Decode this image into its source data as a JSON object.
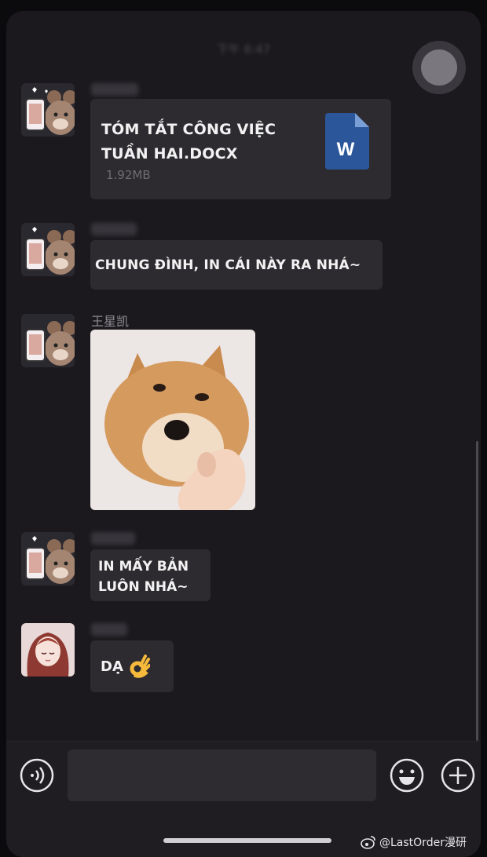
{
  "status": {
    "time_text": "下午 6:47"
  },
  "messages": [
    {
      "type": "file",
      "sender_name": "",
      "file_name": "TÓM TẮT CÔNG VIỆC TUẦN HAI.DOCX",
      "file_size": "1.92MB",
      "file_icon": "word-doc-icon"
    },
    {
      "type": "text",
      "sender_name": "",
      "text": "CHUNG ĐÌNH, IN CÁI NÀY RA NHÁ~"
    },
    {
      "type": "image",
      "sender_name": "王星凯",
      "image": "shiba-dog-pointing-photo"
    },
    {
      "type": "text",
      "sender_name": "",
      "text": "IN MẤY BẢN LUÔN NHÁ~"
    },
    {
      "type": "text",
      "sender_name": "",
      "text": "DẠ"
    }
  ],
  "input": {
    "placeholder": "",
    "value": ""
  },
  "icons": {
    "voice": "voice-icon",
    "emoji": "emoji-icon",
    "add": "add-icon",
    "ok_hand": "ok-hand-emoji"
  },
  "watermark": {
    "text": "@LastOrder漫研"
  },
  "colors": {
    "background": "#1b191e",
    "bubble": "#2d2b30",
    "word_blue": "#2b579a"
  }
}
